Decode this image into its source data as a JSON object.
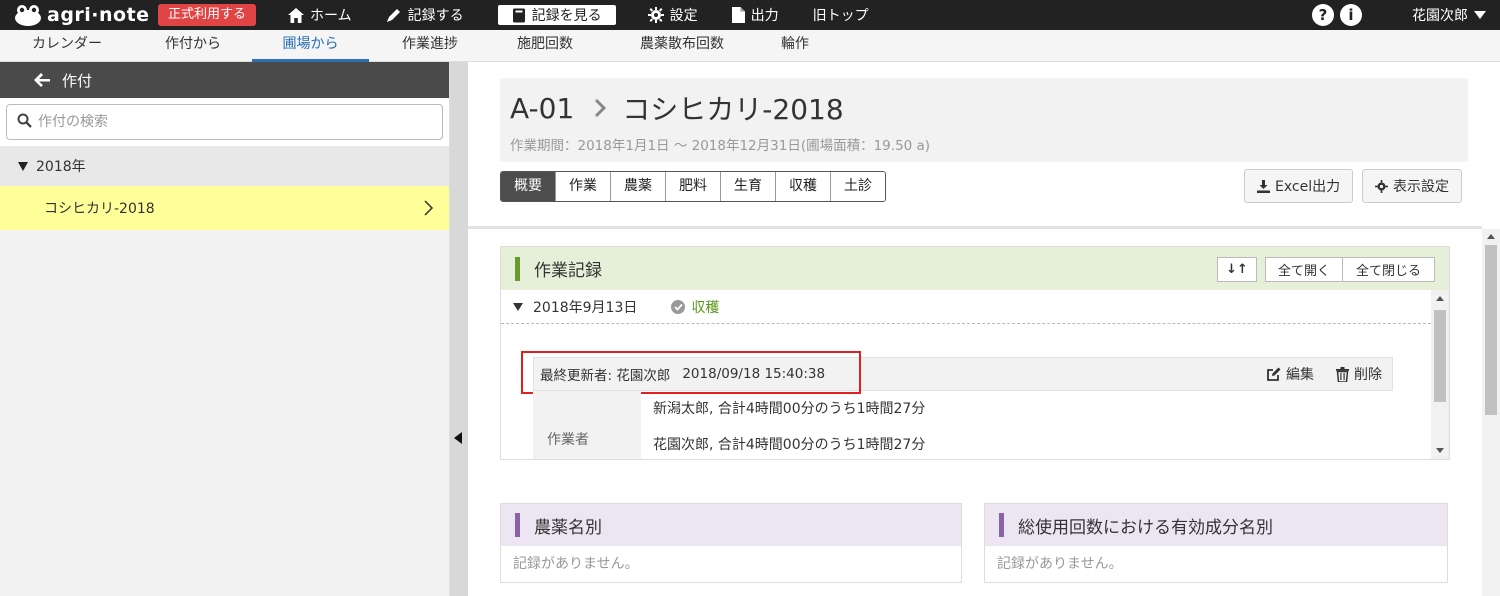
{
  "topbar": {
    "logo_text": "agri·note",
    "official_label": "正式利用する",
    "nav": [
      {
        "label": "ホーム",
        "icon": "home-icon"
      },
      {
        "label": "記録する",
        "icon": "pencil-icon"
      },
      {
        "label": "記録を見る",
        "icon": "book-icon"
      },
      {
        "label": "設定",
        "icon": "gear-icon"
      },
      {
        "label": "出力",
        "icon": "document-icon"
      },
      {
        "label": "旧トップ",
        "icon": ""
      }
    ],
    "help_glyph": "?",
    "info_glyph": "i",
    "user_name": "花園次郎"
  },
  "subnav": {
    "items": [
      "カレンダー",
      "作付から",
      "圃場から",
      "作業進捗",
      "施肥回数",
      "農薬散布回数",
      "輪作"
    ],
    "active_index": 2
  },
  "sidebar": {
    "header": "作付",
    "search_placeholder": "作付の検索",
    "year": "2018年",
    "crop": "コシヒカリ-2018"
  },
  "main": {
    "field_code": "A-01",
    "crop_title": "コシヒカリ-2018",
    "period": "作業期間：2018年1月1日 〜 2018年12月31日(圃場面積：19.50 a)",
    "tabs": [
      "概要",
      "作業",
      "農薬",
      "肥料",
      "生育",
      "収穫",
      "土診"
    ],
    "active_tab": 0,
    "excel_button": "Excel出力",
    "display_settings_button": "表示設定"
  },
  "work_record": {
    "title": "作業記録",
    "sort_glyph": "↓↑",
    "expand_all": "全て開く",
    "collapse_all": "全て閉じる",
    "date": "2018年9月13日",
    "status": "収穫",
    "updater_label": "最終更新者: 花園次郎",
    "updated_at": "2018/09/18 15:40:38",
    "edit_label": "編集",
    "delete_label": "削除",
    "worker_label": "作業者",
    "workers": [
      "新潟太郎, 合計4時間00分のうち1時間27分",
      "花園次郎, 合計4時間00分のうち1時間27分"
    ]
  },
  "pesticide_panel": {
    "title": "農薬名別",
    "empty": "記録がありません。"
  },
  "ingredient_panel": {
    "title": "総使用回数における有効成分名別",
    "empty": "記録がありません。"
  },
  "colors": {
    "topbar": "#222222",
    "official": "#e04444",
    "active_subnav": "#2b6fb5",
    "selected_crop": "#ffff99",
    "work_header": "#e6f0d8",
    "green_accent": "#6a9a2b",
    "purple_accent": "#8b62a8",
    "highlight": "#e02020"
  }
}
